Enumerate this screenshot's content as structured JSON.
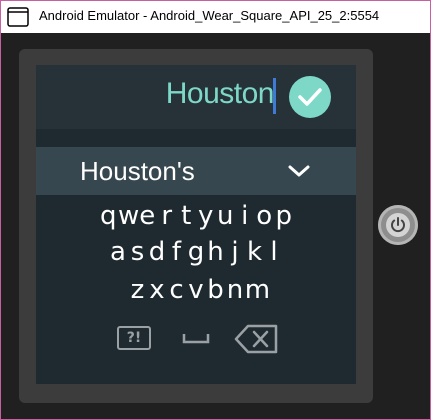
{
  "window": {
    "title": "Android Emulator - Android_Wear_Square_API_25_2:5554"
  },
  "watch": {
    "input": {
      "text": "Houston"
    },
    "suggestion": {
      "text": "Houston's"
    },
    "keyboard": {
      "row1": [
        "q",
        "w",
        "e",
        "r",
        "t",
        "y",
        "u",
        "i",
        "o",
        "p"
      ],
      "row2": [
        "a",
        "s",
        "d",
        "f",
        "g",
        "h",
        "j",
        "k",
        "l"
      ],
      "row3": [
        "z",
        "x",
        "c",
        "v",
        "b",
        "n",
        "m"
      ],
      "symbols_label": "?!"
    }
  },
  "colors": {
    "accent": "#7ed8c8",
    "cursor": "#3d7bd6",
    "screen_bg": "#1f2a30",
    "suggestion_bg": "#37474f"
  },
  "icons": {
    "confirm": "check-icon",
    "expand": "chevron-down-icon",
    "space": "space-icon",
    "backspace": "backspace-icon",
    "power": "power-icon"
  }
}
